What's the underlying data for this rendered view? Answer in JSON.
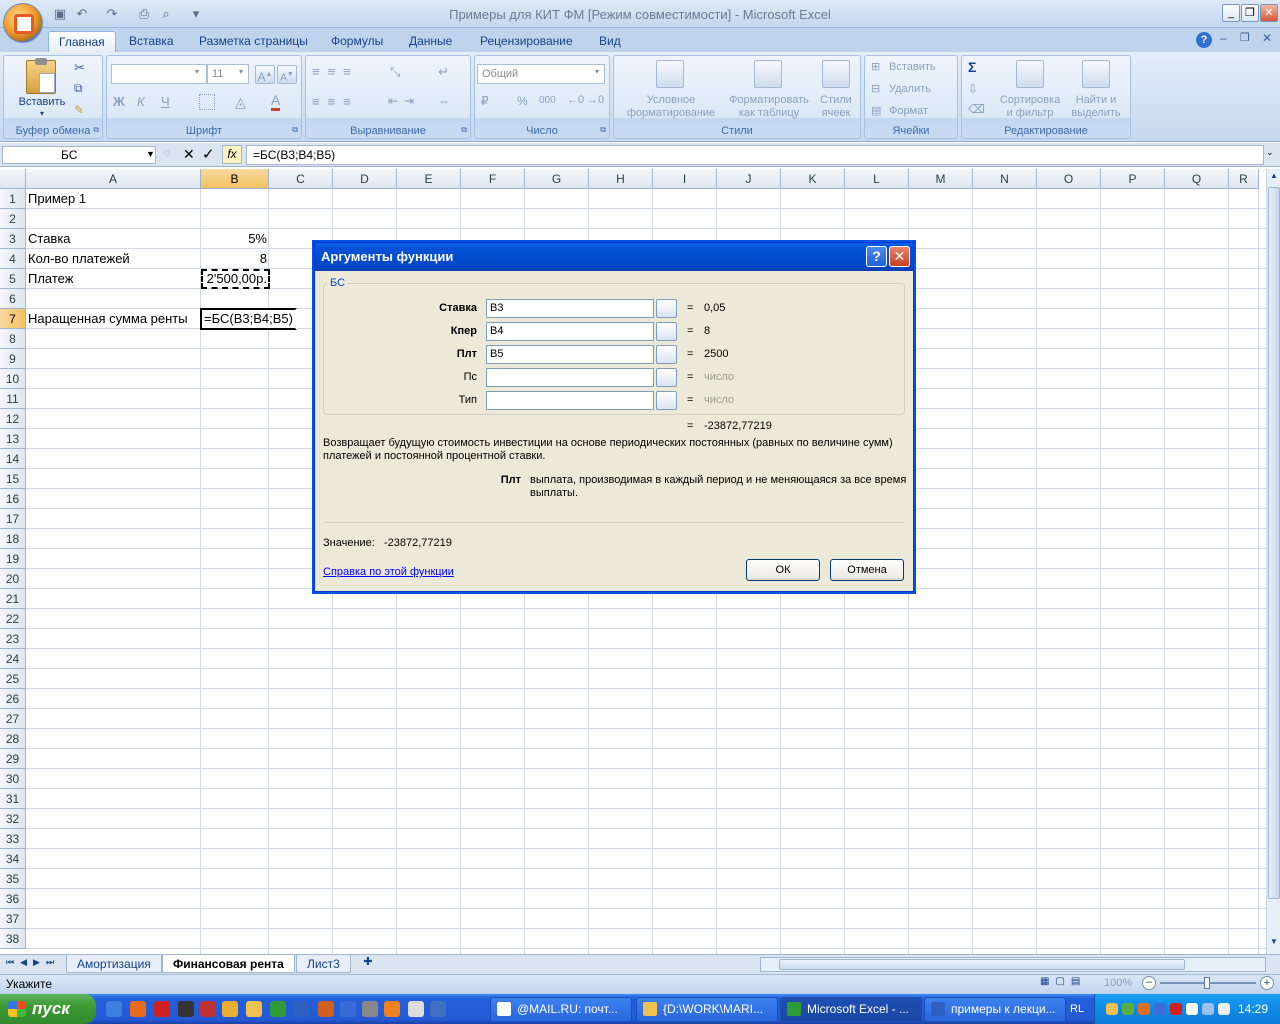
{
  "window": {
    "title": "Примеры для КИТ ФМ  [Режим совместимости] - Microsoft Excel"
  },
  "ribbon": {
    "tabs": [
      "Главная",
      "Вставка",
      "Разметка страницы",
      "Формулы",
      "Данные",
      "Рецензирование",
      "Вид"
    ],
    "active_tab": "Главная",
    "clipboard": {
      "paste_label": "Вставить",
      "group_label": "Буфер обмена"
    },
    "font": {
      "size_value": "11",
      "group_label": "Шрифт"
    },
    "alignment": {
      "group_label": "Выравнивание"
    },
    "number": {
      "format_value": "Общий",
      "group_label": "Число",
      "percent": "%",
      "thousands": "000"
    },
    "styles": {
      "conditional_line1": "Условное",
      "conditional_line2": "форматирование",
      "table_line1": "Форматировать",
      "table_line2": "как таблицу",
      "cell_line1": "Стили",
      "cell_line2": "ячеек",
      "group_label": "Стили"
    },
    "cells": {
      "insert": "Вставить",
      "delete": "Удалить",
      "format": "Формат",
      "group_label": "Ячейки"
    },
    "editing": {
      "sort_line1": "Сортировка",
      "sort_line2": "и фильтр",
      "find_line1": "Найти и",
      "find_line2": "выделить",
      "group_label": "Редактирование"
    }
  },
  "formula_bar": {
    "name_box": "БС",
    "formula": "=БС(B3;B4;B5)"
  },
  "columns": [
    "A",
    "B",
    "C",
    "D",
    "E",
    "F",
    "G",
    "H",
    "I",
    "J",
    "K",
    "L",
    "M",
    "N",
    "O",
    "P",
    "Q",
    "R"
  ],
  "rows": [
    "1",
    "2",
    "3",
    "4",
    "5",
    "6",
    "7",
    "8",
    "9",
    "10",
    "11",
    "12",
    "13",
    "14",
    "15",
    "16",
    "17",
    "18",
    "19",
    "20",
    "21",
    "22",
    "23",
    "24",
    "25",
    "26",
    "27",
    "28",
    "29",
    "30",
    "31",
    "32",
    "33",
    "34",
    "35",
    "36",
    "37",
    "38"
  ],
  "cells": {
    "a1": "Пример 1",
    "a3": "Ставка",
    "b3": "5%",
    "a4": "Кол-во платежей",
    "b4": "8",
    "a5": "Платеж",
    "b5": "2'500,00р.",
    "a7": "Наращенная сумма ренты",
    "b7": "=БС(B3;B4;B5)"
  },
  "sheets": [
    "Амортизация",
    "Финансовая рента",
    "Лист3"
  ],
  "active_sheet": "Финансовая рента",
  "status": {
    "mode": "Укажите",
    "zoom": "100%"
  },
  "dialog": {
    "title": "Аргументы функции",
    "function_name": "БС",
    "args": [
      {
        "label": "Ставка",
        "value": "B3",
        "result": "0,05",
        "bold": true
      },
      {
        "label": "Кпер",
        "value": "B4",
        "result": "8",
        "bold": true
      },
      {
        "label": "Плт",
        "value": "B5",
        "result": "2500",
        "bold": true
      },
      {
        "label": "Пс",
        "value": "",
        "result": "число",
        "bold": false
      },
      {
        "label": "Тип",
        "value": "",
        "result": "число",
        "bold": false
      }
    ],
    "total_result": "-23872,77219",
    "description": "Возвращает будущую стоимость инвестиции на основе периодических постоянных (равных по величине сумм) платежей и постоянной процентной ставки.",
    "param_name": "Плт",
    "param_description": "выплата, производимая в каждый период и не меняющаяся за все время выплаты.",
    "value_label": "Значение:",
    "value": "-23872,77219",
    "help_link": "Справка по этой функции",
    "ok": "ОК",
    "cancel": "Отмена",
    "equals": "="
  },
  "taskbar": {
    "start": "пуск",
    "tasks": [
      "@MAIL.RU: почт...",
      "{D:\\WORK\\MARI...",
      "Microsoft Excel - ...",
      "примеры к лекци..."
    ],
    "lang": "RL",
    "clock": "14:29"
  }
}
